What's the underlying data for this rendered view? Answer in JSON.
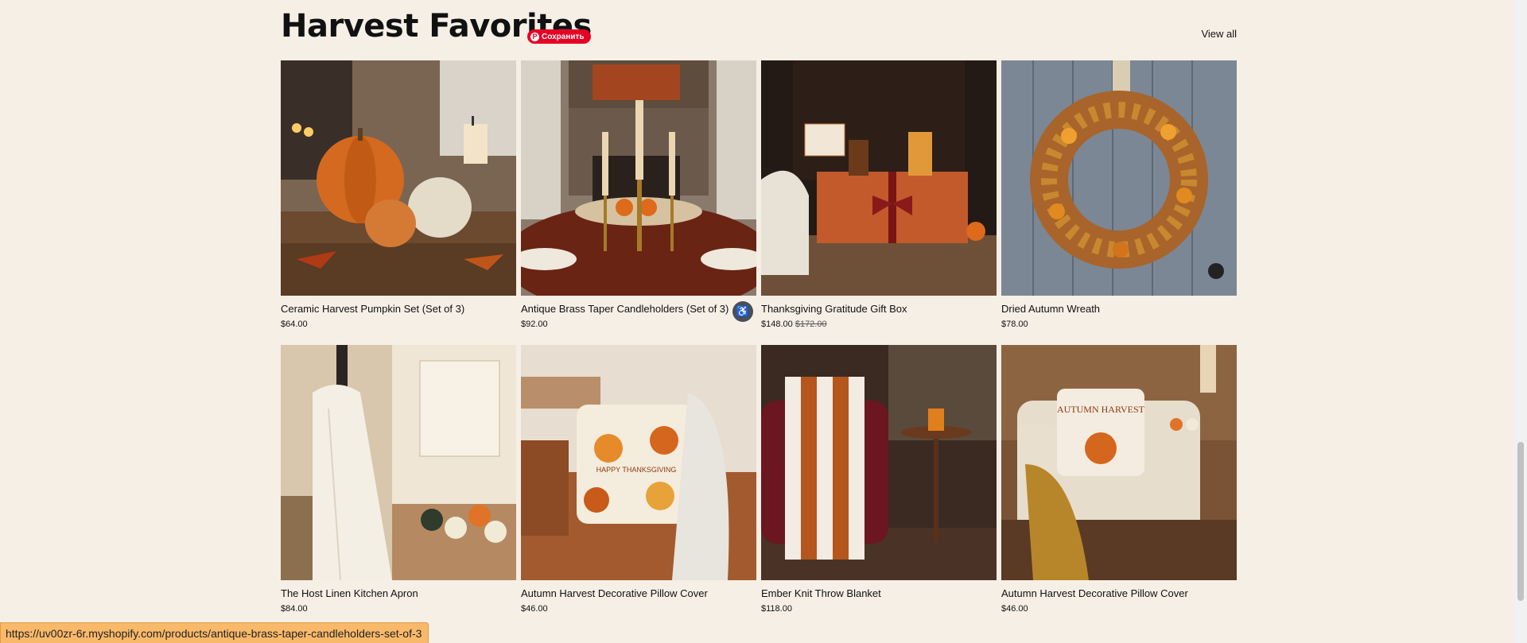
{
  "section": {
    "title": "Harvest Favorites",
    "view_all": "View all",
    "pin_label": "Сохранить"
  },
  "products": [
    {
      "name": "Ceramic Harvest Pumpkin Set (Set of 3)",
      "price": "$64.00",
      "compare_price": ""
    },
    {
      "name": "Antique Brass Taper Candleholders (Set of 3)",
      "price": "$92.00",
      "compare_price": ""
    },
    {
      "name": "Thanksgiving Gratitude Gift Box",
      "price": "$148.00",
      "compare_price": "$172.00"
    },
    {
      "name": "Dried Autumn Wreath",
      "price": "$78.00",
      "compare_price": ""
    },
    {
      "name": "The Host Linen Kitchen Apron",
      "price": "$84.00",
      "compare_price": ""
    },
    {
      "name": "Autumn Harvest Decorative Pillow Cover",
      "price": "$46.00",
      "compare_price": ""
    },
    {
      "name": "Ember Knit Throw Blanket",
      "price": "$118.00",
      "compare_price": ""
    },
    {
      "name": "Autumn Harvest Decorative Pillow Cover",
      "price": "$46.00",
      "compare_price": ""
    }
  ],
  "pillow_text_1": "HAPPY THANKSGIVING",
  "pillow_text_2": "AUTUMN HARVEST",
  "status_bar": {
    "url": "https://uv00zr-6r.myshopify.com/products/antique-brass-taper-candleholders-set-of-3"
  },
  "icons": {
    "pin": "pinterest-icon",
    "accessibility": "accessibility-icon"
  }
}
